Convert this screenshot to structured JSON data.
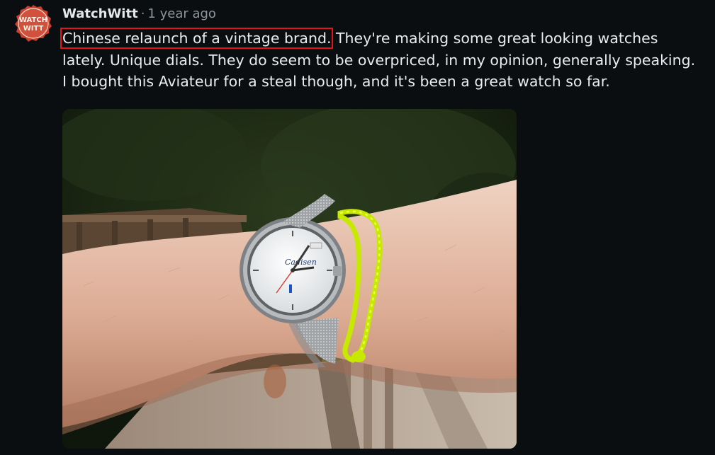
{
  "comment": {
    "avatar_text_line1": "WATCH",
    "avatar_text_line2": "WITT",
    "username": "WatchWitt",
    "separator": "·",
    "timestamp": "1 year ago",
    "body_highlighted": "Chinese relaunch of a vintage brand.",
    "body_rest": "They're making some great looking watches lately. Unique dials. They do seem to be overpriced, in my opinion, generally speaking. I bought this Aviateur for a steal though, and it's been a great watch so far."
  },
  "dial_text": "Cadisen",
  "colors": {
    "background": "#0b0e11",
    "highlight_box": "#e0161b",
    "avatar_red": "#c8412e",
    "muted_text": "#8d969c"
  }
}
